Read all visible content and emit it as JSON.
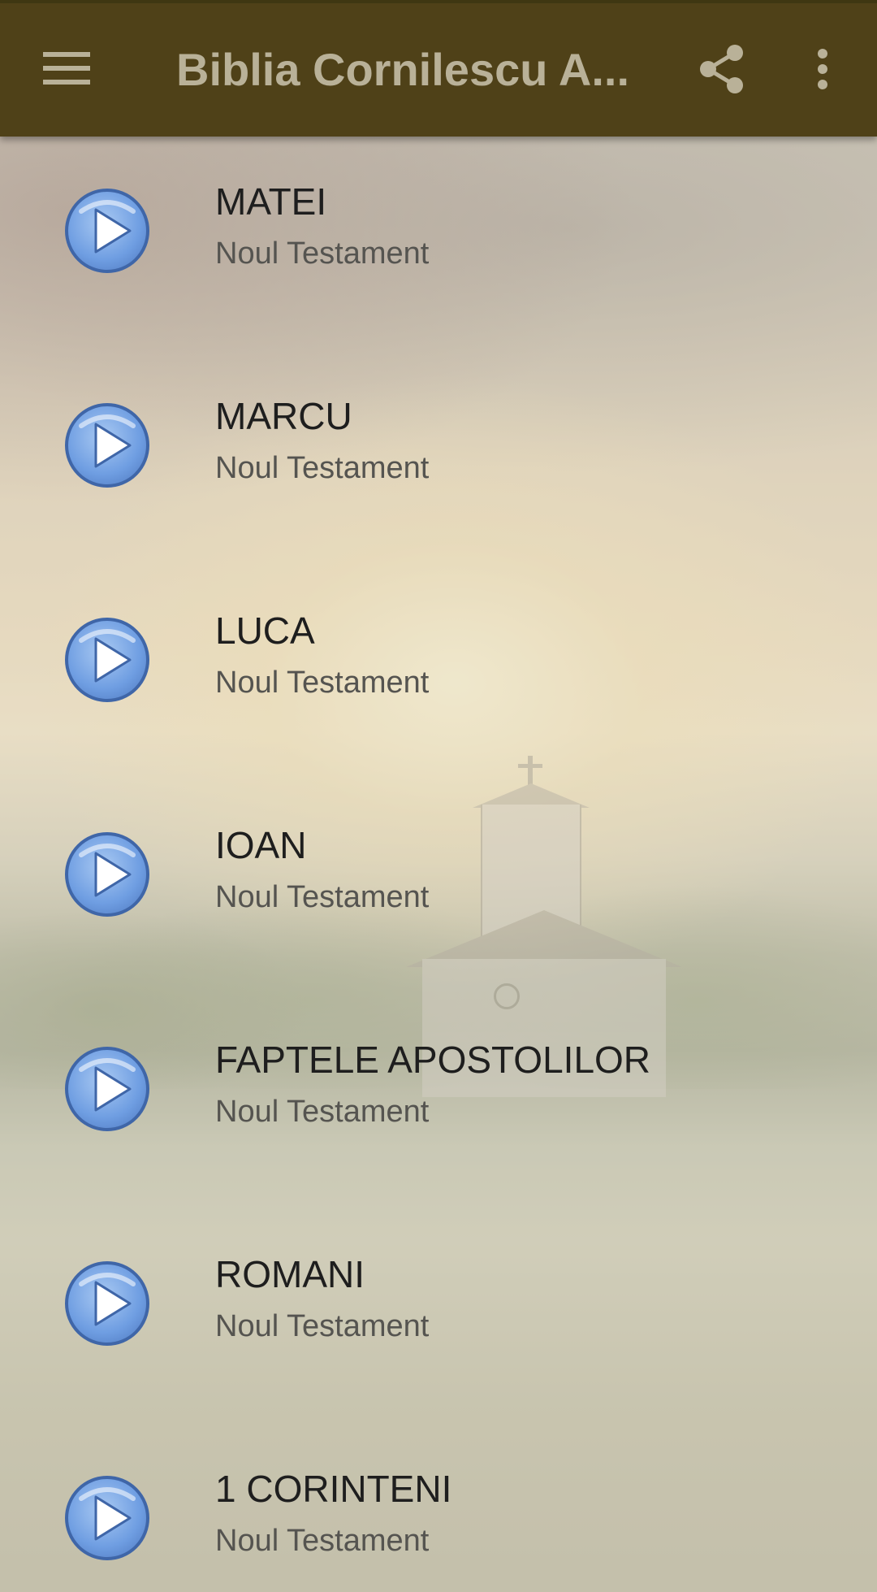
{
  "app_bar": {
    "title": "Biblia Cornilescu A...",
    "menu_icon": "hamburger-menu-icon",
    "share_icon": "share-icon",
    "more_icon": "more-vert-icon",
    "background_color": "#4f4118",
    "title_color": "#b9b198"
  },
  "list": {
    "play_icon": "play-circle-icon",
    "items": [
      {
        "title": "MATEI",
        "subtitle": "Noul Testament"
      },
      {
        "title": "MARCU",
        "subtitle": "Noul Testament"
      },
      {
        "title": "LUCA",
        "subtitle": "Noul Testament"
      },
      {
        "title": "IOAN",
        "subtitle": "Noul Testament"
      },
      {
        "title": "FAPTELE APOSTOLILOR",
        "subtitle": "Noul Testament"
      },
      {
        "title": "ROMANI",
        "subtitle": "Noul Testament"
      },
      {
        "title": "1 CORINTENI",
        "subtitle": "Noul Testament"
      }
    ]
  }
}
